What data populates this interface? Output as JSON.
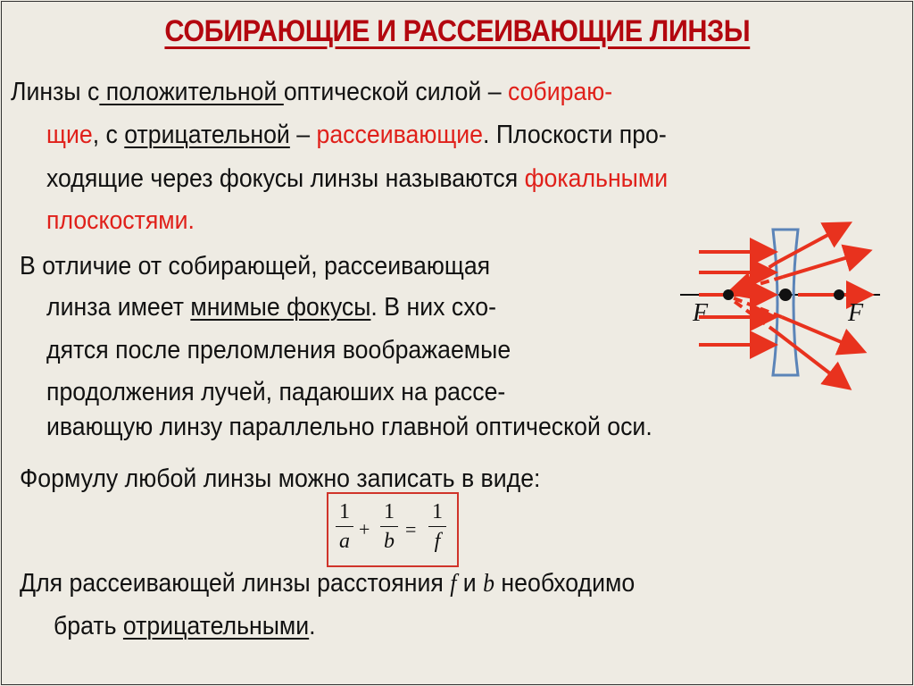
{
  "title": "СОБИРАЮЩИЕ И РАССЕИВАЮЩИЕ ЛИНЗЫ",
  "paragraph1": {
    "l1_a": "Линзы с",
    "l1_u": " положительной ",
    "l1_b": "оптической силой – ",
    "l1_red": "собираю-",
    "l2_red1": "щие",
    "l2_a": ", с ",
    "l2_u": "отрицательной",
    "l2_b": " – ",
    "l2_red2": "рассеивающие",
    "l2_c": ". Плоскости про-",
    "l3_a": "ходящие через фокусы линзы называются ",
    "l3_red": "фокальными",
    "l4_red": "плоскостями."
  },
  "paragraph2": {
    "l1": "В отличие от собирающей, рассеивающая",
    "l2_a": "линза имеет ",
    "l2_u": "мнимые фокусы",
    "l2_b": ". В них схо-",
    "l3": "дятся после преломления воображаемые",
    "l4": "продолжения лучей, падаюших на рассе-",
    "l5": "ивающую линзу параллельно главной оптической оси."
  },
  "paragraph3": {
    "l1": "Формулу любой линзы можно записать в виде:"
  },
  "formula": {
    "num1": "1",
    "den1": "a",
    "plus": "+",
    "num2": "1",
    "den2": "b",
    "equals": "=",
    "num3": "1",
    "den3": "f"
  },
  "paragraph4": {
    "l1_a": "Для рассеивающей линзы расстояния ",
    "var_f": "f",
    "l1_b": " и ",
    "var_b": "b",
    "l1_c": " необходимо",
    "l2_a": "брать ",
    "l2_u": "отрицательными",
    "l2_b": "."
  },
  "diagram": {
    "focus_left_label": "F",
    "focus_right_label": "F",
    "colors": {
      "rays": "#e8321e",
      "lens": "#5b84b8",
      "axis": "#111111"
    }
  }
}
